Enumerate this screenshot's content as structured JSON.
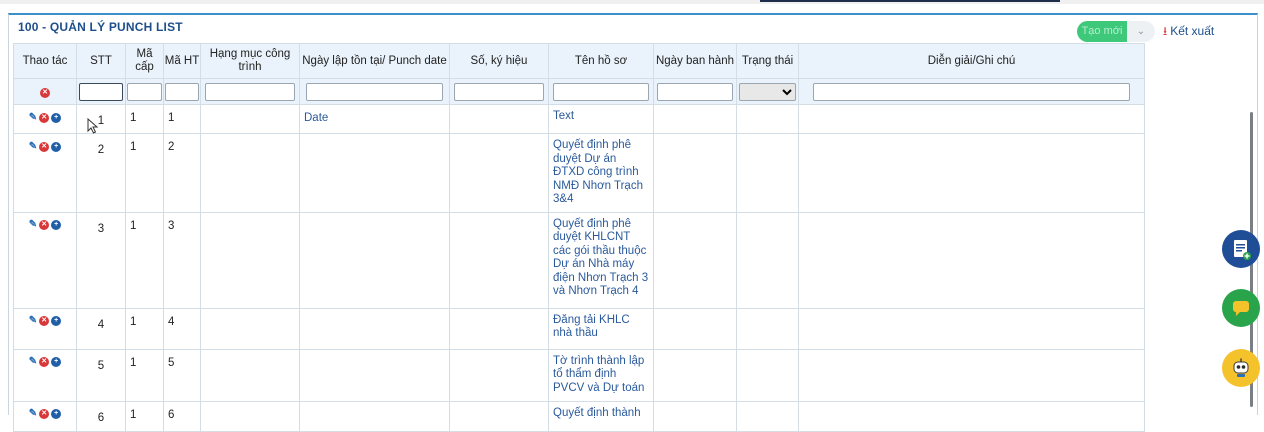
{
  "page": {
    "title": "100 - QUẢN LÝ PUNCH LIST"
  },
  "toolbar": {
    "new_label": "Tạo mới",
    "dropdown_label": "⌄",
    "export_label": "Kết xuất"
  },
  "columns": [
    "Thao tác",
    "STT",
    "Mã cấp",
    "Mã HT",
    "Hạng mục công trình",
    "Ngày lập tồn tại/ Punch date",
    "Số, ký hiệu",
    "Tên hồ sơ",
    "Ngày ban hành",
    "Trạng thái",
    "Diễn giải/Ghi chú"
  ],
  "rows": [
    {
      "stt": "1",
      "ma_cap": "1",
      "ma_ht": "1",
      "hang_muc": "",
      "ngay_lap": "Date",
      "so_ky_hieu": "",
      "ten_ho_so": "Text",
      "ngay_ban_hanh": "",
      "trang_thai": "",
      "dien_giai": ""
    },
    {
      "stt": "2",
      "ma_cap": "1",
      "ma_ht": "2",
      "hang_muc": "",
      "ngay_lap": "",
      "so_ky_hieu": "",
      "ten_ho_so": "Quyết định phê duyệt Dự án ĐTXD công trình NMĐ Nhơn Trạch 3&4",
      "ngay_ban_hanh": "",
      "trang_thai": "",
      "dien_giai": ""
    },
    {
      "stt": "3",
      "ma_cap": "1",
      "ma_ht": "3",
      "hang_muc": "",
      "ngay_lap": "",
      "so_ky_hieu": "",
      "ten_ho_so": "Quyết định phê duyệt KHLCNT các gói thầu thuộc Dự án Nhà máy điện Nhơn Trạch 3 và Nhơn Trạch 4",
      "ngay_ban_hanh": "",
      "trang_thai": "",
      "dien_giai": ""
    },
    {
      "stt": "4",
      "ma_cap": "1",
      "ma_ht": "4",
      "hang_muc": "",
      "ngay_lap": "",
      "so_ky_hieu": "",
      "ten_ho_so": "Đăng tải KHLC nhà thầu",
      "ngay_ban_hanh": "",
      "trang_thai": "",
      "dien_giai": ""
    },
    {
      "stt": "5",
      "ma_cap": "1",
      "ma_ht": "5",
      "hang_muc": "",
      "ngay_lap": "",
      "so_ky_hieu": "",
      "ten_ho_so": "Tờ trình thành lập tổ thẩm định PVCV và Dự toán",
      "ngay_ban_hanh": "",
      "trang_thai": "",
      "dien_giai": ""
    },
    {
      "stt": "6",
      "ma_cap": "1",
      "ma_ht": "6",
      "hang_muc": "",
      "ngay_lap": "",
      "so_ky_hieu": "",
      "ten_ho_so": "Quyết định thành",
      "ngay_ban_hanh": "",
      "trang_thai": "",
      "dien_giai": ""
    }
  ],
  "icons": {
    "edit": "pencil-icon",
    "delete": "delete-icon",
    "add": "add-icon",
    "clear_filter": "clear-filter-icon",
    "export": "download-icon",
    "fab1": "document-add-icon",
    "fab2": "chat-icon",
    "fab3": "robot-icon"
  },
  "colors": {
    "accent": "#3d8fc7",
    "title": "#1d4f8c",
    "link": "#2a5a9c",
    "delete": "#d8383a",
    "new_button": "#3ec97a",
    "header_bg": "#eaf3fb"
  }
}
